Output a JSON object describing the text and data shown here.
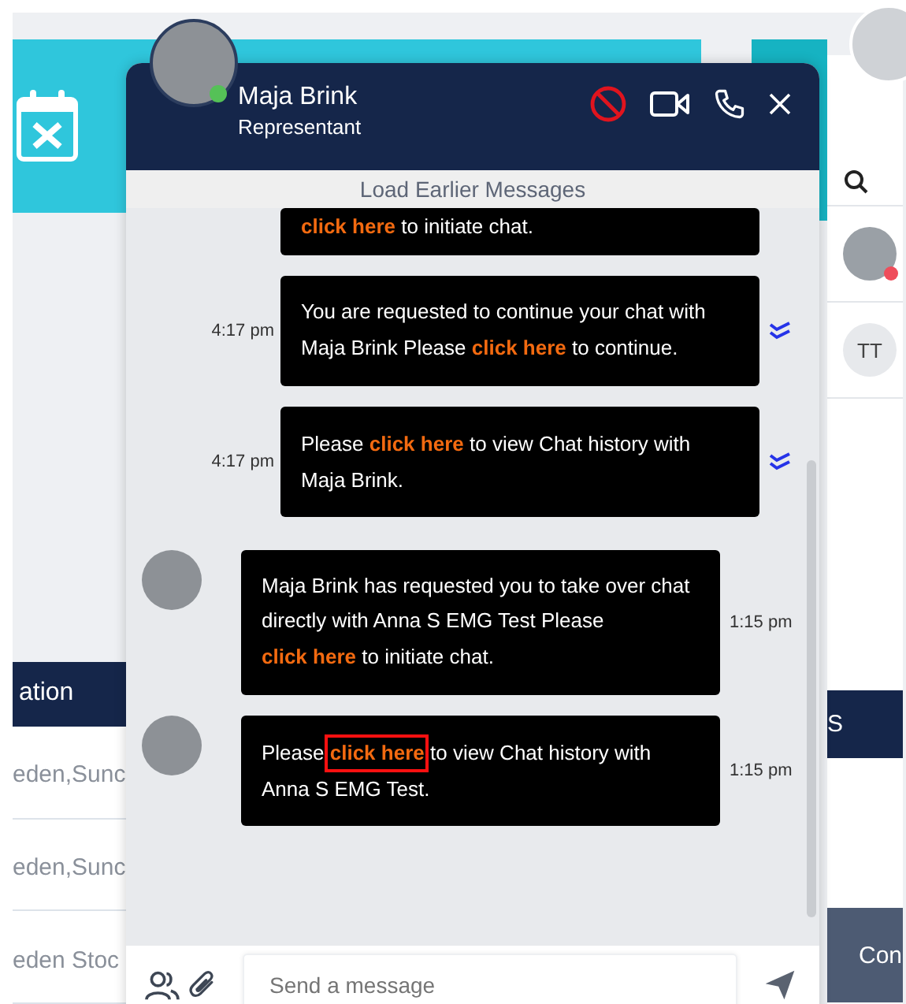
{
  "background": {
    "table_header": "ation",
    "side_header": "S",
    "rows": [
      "eden,Sunc",
      "eden,Sunc",
      "eden Stoc"
    ],
    "contacts": [
      {
        "kind": "photo",
        "color": "#ef4d5b"
      },
      {
        "kind": "initials",
        "initials": "TT"
      }
    ],
    "side_button": "Con"
  },
  "chat": {
    "name": "Maja Brink",
    "role": "Representant",
    "online": true,
    "load_earlier": "Load Earlier Messages",
    "input": {
      "placeholder": "Send a message"
    },
    "messages": [
      {
        "kind": "partial",
        "link": "click here",
        "text_after": " to initiate chat."
      },
      {
        "kind": "sent",
        "time": "4:17 pm",
        "read": true,
        "text_before": "You are requested to continue your chat with Maja Brink Please ",
        "link": "click here",
        "text_after": " to continue."
      },
      {
        "kind": "sent",
        "time": "4:17 pm",
        "read": true,
        "text_before": "Please ",
        "link": "click here",
        "text_after": " to view Chat history with Maja Brink."
      },
      {
        "kind": "received",
        "time": "1:15 pm",
        "text_before": "Maja Brink has requested you to take over chat directly with Anna S EMG Test Please ",
        "link": "click here",
        "text_after": " to initiate chat."
      },
      {
        "kind": "received",
        "time": "1:15 pm",
        "text_before": "Please ",
        "link": "click here",
        "text_after": " to view Chat history with Anna S EMG Test.",
        "highlighted": true
      }
    ]
  }
}
